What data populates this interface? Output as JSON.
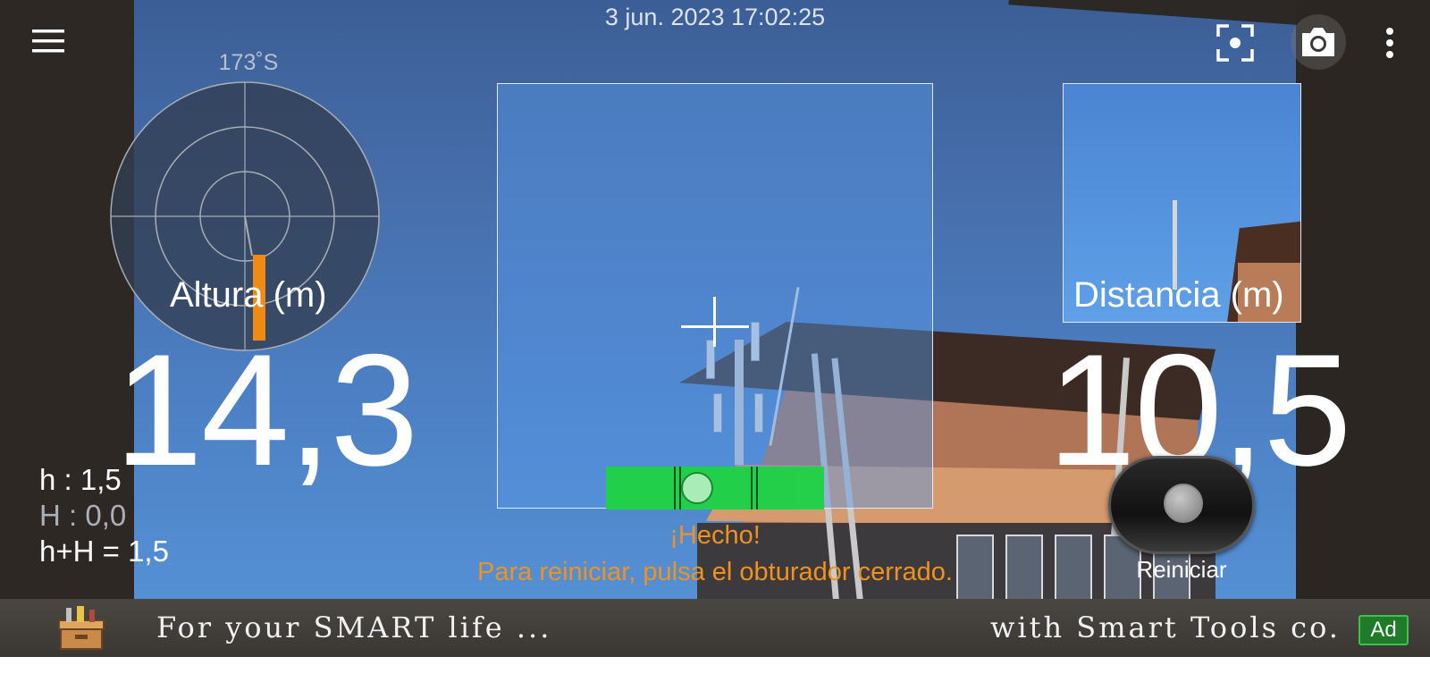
{
  "header": {
    "timestamp": "3 jun. 2023 17:02:25",
    "icons": [
      "menu-icon",
      "focus-icon",
      "camera-icon",
      "more-vert-icon"
    ]
  },
  "compass": {
    "heading": "173˚S"
  },
  "height": {
    "label": "Altura (m)",
    "value": "14,3"
  },
  "distance": {
    "label": "Distancia (m)",
    "value": "10,5"
  },
  "readings": {
    "h": "h : 1,5",
    "H": "H : 0,0",
    "sum": "h+H = 1,5"
  },
  "status": {
    "title": "¡Hecho!",
    "message": "Para reiniciar, pulsa el obturador cerrado."
  },
  "shutter": {
    "label": "Reiniciar"
  },
  "ad": {
    "left_text": "For your SMART life ...",
    "right_text": "with Smart Tools co.",
    "badge": "Ad",
    "icon": "toolbox-icon"
  },
  "colors": {
    "accent_orange": "#f0921f",
    "level_green": "#1fd245",
    "ad_badge_green": "#1f7a2a"
  }
}
